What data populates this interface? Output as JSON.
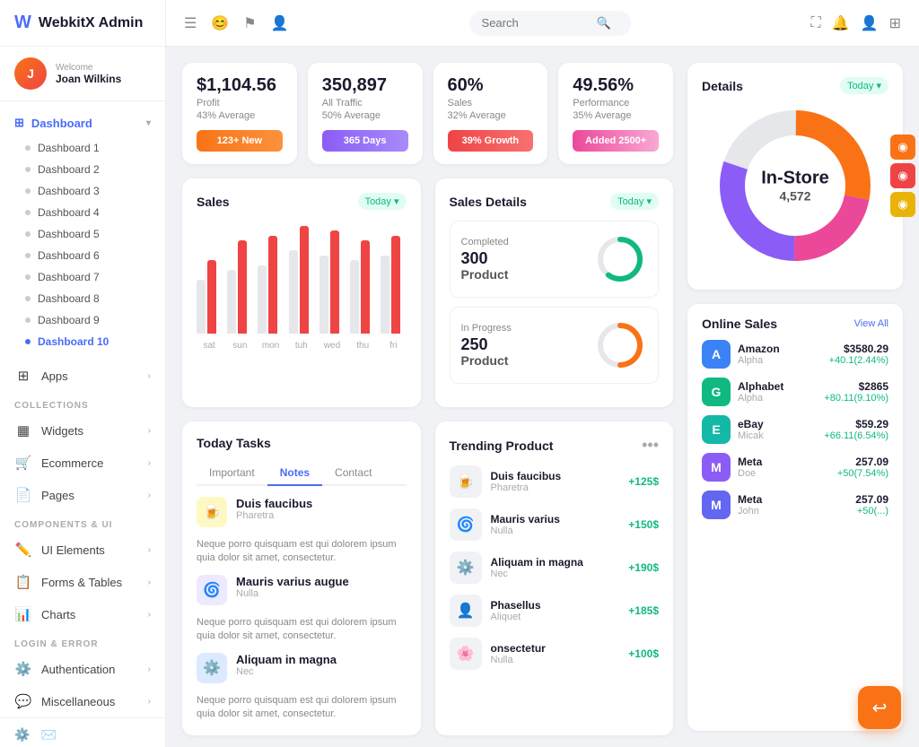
{
  "logo": {
    "icon": "W",
    "text": "WebkitX Admin"
  },
  "user": {
    "welcome": "Welcome",
    "name": "Joan Wilkins",
    "avatar": "J"
  },
  "topbar": {
    "search_placeholder": "Search",
    "icons": [
      "menu-icon",
      "emoji-icon",
      "flag-icon",
      "user-circle-icon"
    ]
  },
  "sidebar": {
    "dashboard_label": "Dashboard",
    "dashboard_items": [
      {
        "label": "Dashboard 1"
      },
      {
        "label": "Dashboard 2"
      },
      {
        "label": "Dashboard 3"
      },
      {
        "label": "Dashboard 4"
      },
      {
        "label": "Dashboard 5"
      },
      {
        "label": "Dashboard 6"
      },
      {
        "label": "Dashboard 7"
      },
      {
        "label": "Dashboard 8"
      },
      {
        "label": "Dashboard 9"
      },
      {
        "label": "Dashboard 10",
        "active": true
      }
    ],
    "collections_label": "COLLECTIONS",
    "collection_items": [
      {
        "label": "Widgets",
        "icon": "▦"
      },
      {
        "label": "Ecommerce",
        "icon": "🛒"
      },
      {
        "label": "Pages",
        "icon": "📄"
      }
    ],
    "components_label": "COMPONENTS & UI",
    "component_items": [
      {
        "label": "UI Elements",
        "icon": "✏️"
      },
      {
        "label": "Forms & Tables",
        "icon": "📋"
      },
      {
        "label": "Charts",
        "icon": "📊"
      }
    ],
    "login_label": "LOGIN & ERROR",
    "login_items": [
      {
        "label": "Authentication",
        "icon": "⚙️"
      },
      {
        "label": "Miscellaneous",
        "icon": "💬"
      }
    ]
  },
  "stats": [
    {
      "amount": "$1,104.56",
      "label": "Profit",
      "percent": "43% Average",
      "btn_label": "123+ New",
      "btn_class": "btn-orange"
    },
    {
      "amount": "350,897",
      "label": "All Traffic",
      "percent": "50% Average",
      "btn_label": "365 Days",
      "btn_class": "btn-purple"
    },
    {
      "amount": "60%",
      "label": "Sales",
      "percent": "32% Average",
      "btn_label": "39% Growth",
      "btn_class": "btn-red"
    },
    {
      "amount": "49.56%",
      "label": "Performance",
      "percent": "35% Average",
      "btn_label": "Added 2500+",
      "btn_class": "btn-pink"
    }
  ],
  "sales_chart": {
    "title": "Sales",
    "badge": "Today ▾",
    "bars": [
      {
        "label": "sat",
        "v1": 55,
        "v2": 75
      },
      {
        "label": "sun",
        "v1": 65,
        "v2": 95
      },
      {
        "label": "mon",
        "v1": 70,
        "v2": 100
      },
      {
        "label": "tuh",
        "v1": 85,
        "v2": 110
      },
      {
        "label": "wed",
        "v1": 80,
        "v2": 105
      },
      {
        "label": "thu",
        "v1": 75,
        "v2": 95
      },
      {
        "label": "fri",
        "v1": 80,
        "v2": 100
      }
    ]
  },
  "sales_details": {
    "title": "Sales Details",
    "badge": "Today ▾",
    "completed": {
      "status": "Completed",
      "title": "300",
      "subtitle": "Product"
    },
    "inprogress": {
      "status": "In Progress",
      "title": "250",
      "subtitle": "Product"
    }
  },
  "today_tasks": {
    "title": "Today Tasks",
    "tabs": [
      "Important",
      "Notes",
      "Contact"
    ],
    "active_tab": 1,
    "items": [
      {
        "icon": "🍺",
        "icon_class": "yellow",
        "title": "Duis faucibus",
        "sub": "Pharetra",
        "desc": "Neque porro quisquam est qui dolorem ipsum quia dolor sit amet, consectetur."
      },
      {
        "icon": "🌀",
        "icon_class": "purple",
        "title": "Mauris varius augue",
        "sub": "Nulla",
        "desc": "Neque porro quisquam est qui dolorem ipsum quia dolor sit amet, consectetur."
      },
      {
        "icon": "⚙️",
        "icon_class": "blue",
        "title": "Aliquam in magna",
        "sub": "Nec",
        "desc": "Neque porro quisquam est qui dolorem ipsum quia dolor sit amet, consectetur."
      }
    ]
  },
  "trending": {
    "title": "Trending Product",
    "items": [
      {
        "icon": "🍺",
        "name": "Duis faucibus",
        "sub": "Pharetra",
        "price": "+125$"
      },
      {
        "icon": "🌀",
        "name": "Mauris varius",
        "sub": "Nulla",
        "price": "+150$"
      },
      {
        "icon": "⚙️",
        "name": "Aliquam in magna",
        "sub": "Nec",
        "price": "+190$"
      },
      {
        "icon": "👤",
        "name": "Phasellus",
        "sub": "Aliquet",
        "price": "+185$"
      },
      {
        "icon": "🌸",
        "name": "onsectetur",
        "sub": "Nulla",
        "price": "+100$"
      }
    ]
  },
  "details": {
    "title": "Details",
    "badge": "Today ▾",
    "donut": {
      "main": "In-Store",
      "sub": "4,572"
    },
    "segments": [
      {
        "color": "#f97316",
        "value": 0.28
      },
      {
        "color": "#ec4899",
        "value": 0.22
      },
      {
        "color": "#8b5cf6",
        "value": 0.3
      },
      {
        "color": "#e5e7eb",
        "value": 0.2
      }
    ]
  },
  "online_sales": {
    "title": "Online Sales",
    "view_all": "View All",
    "items": [
      {
        "initial": "A",
        "av_class": "sales-av-blue",
        "name": "Amazon",
        "sub": "Alpha",
        "price": "$3580.29",
        "change": "+40.1(2.44%)"
      },
      {
        "initial": "G",
        "av_class": "sales-av-green",
        "name": "Alphabet",
        "sub": "Alpha",
        "price": "$2865",
        "change": "+80.11(9.10%)"
      },
      {
        "initial": "E",
        "av_class": "sales-av-teal",
        "name": "eBay",
        "sub": "Micak",
        "price": "$59.29",
        "change": "+66.11(6.54%)"
      },
      {
        "initial": "M",
        "av_class": "sales-av-purple",
        "name": "Meta",
        "sub": "Doe",
        "price": "257.09",
        "change": "+50(7.54%)"
      },
      {
        "initial": "M",
        "av_class": "sales-av-indigo",
        "name": "Meta",
        "sub": "John",
        "price": "257.09",
        "change": "+50(...)"
      }
    ]
  }
}
